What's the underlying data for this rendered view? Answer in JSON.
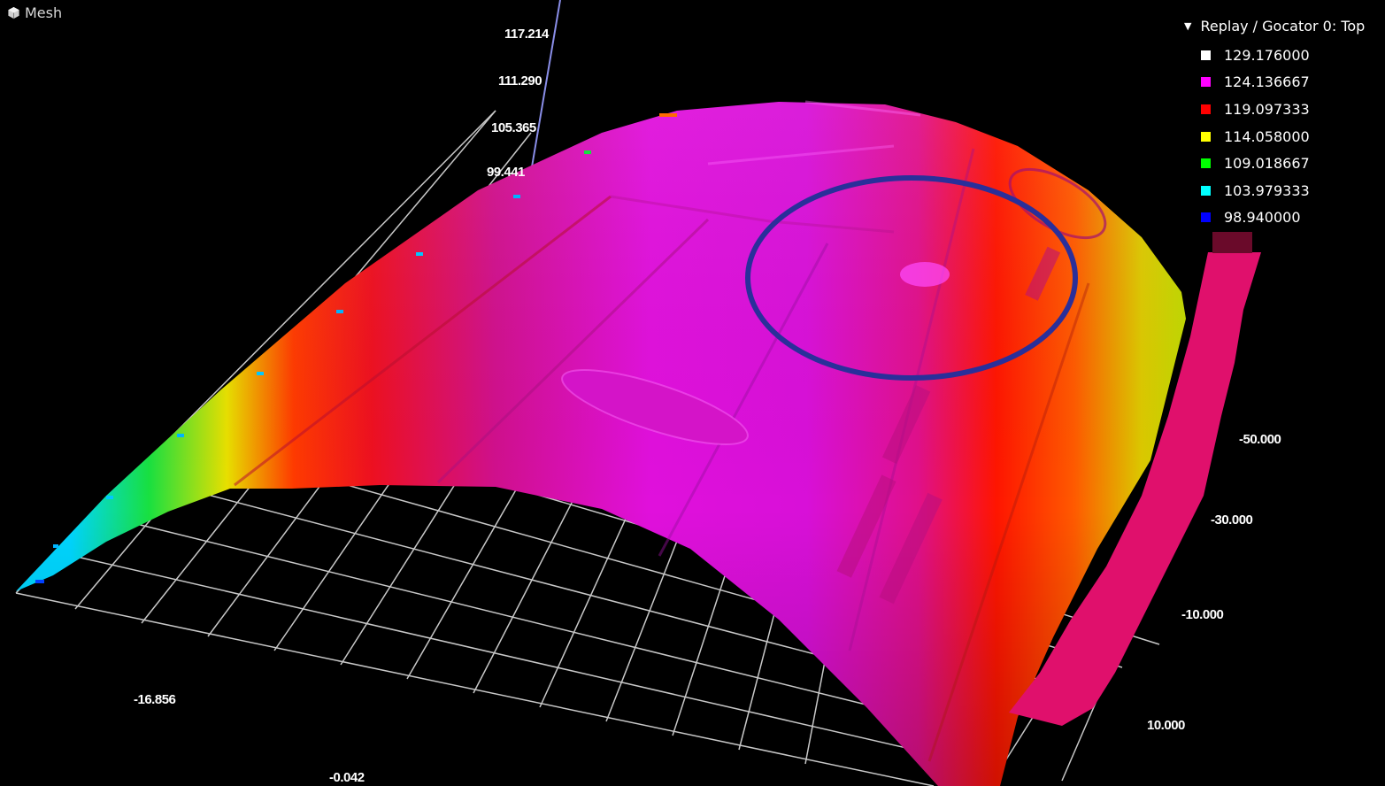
{
  "view": {
    "tab_label": "Mesh",
    "tab_icon": "cube-icon"
  },
  "legend": {
    "title": "Replay / Gocator 0: Top",
    "collapse_icon": "triangle-down-icon",
    "items": [
      {
        "value": "129.176000",
        "color": "#ffffff"
      },
      {
        "value": "124.136667",
        "color": "#ff00ff"
      },
      {
        "value": "119.097333",
        "color": "#ff0000"
      },
      {
        "value": "114.058000",
        "color": "#ffff00"
      },
      {
        "value": "109.018667",
        "color": "#00ff00"
      },
      {
        "value": "103.979333",
        "color": "#00ffff"
      },
      {
        "value": "98.940000",
        "color": "#0000ff"
      }
    ]
  },
  "axes": {
    "z_ticks": [
      "117.214",
      "111.290",
      "105.365",
      "99.441"
    ],
    "x_ticks": [
      "-16.856",
      "-0.042"
    ],
    "y_ticks": [
      "-50.000",
      "-30.000",
      "-10.000",
      "10.000"
    ]
  },
  "annotation": {
    "highlight_color": "#2a2f9a"
  }
}
